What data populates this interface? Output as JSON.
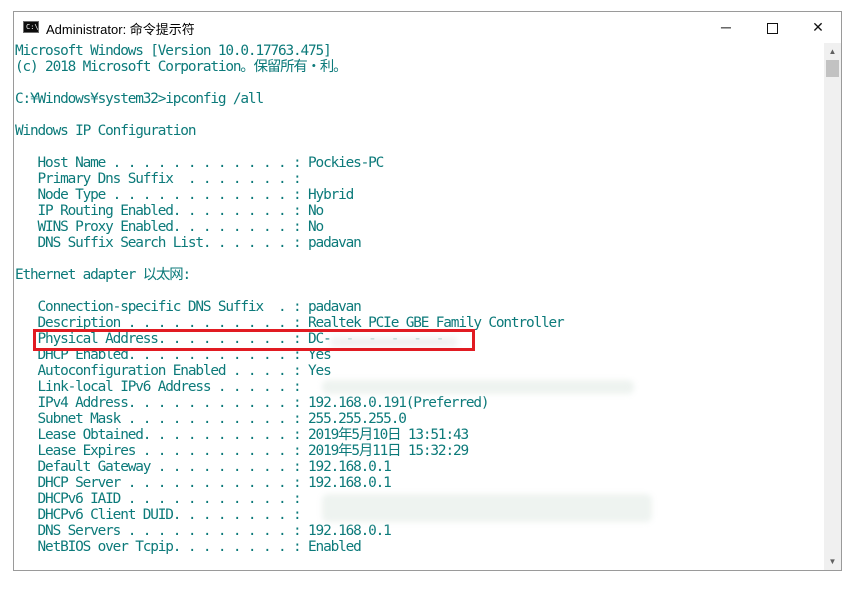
{
  "window": {
    "title": "Administrator: 命令提示符",
    "icon_label": "C:\\",
    "controls": {
      "minimize": "─",
      "close": "✕"
    }
  },
  "console": {
    "lines": [
      "Microsoft Windows [Version 10.0.17763.475]",
      "(c) 2018 Microsoft Corporation。保留所有・利。",
      "",
      "C:¥Windows¥system32>ipconfig /all",
      "",
      "Windows IP Configuration",
      "",
      "   Host Name . . . . . . . . . . . . : Pockies-PC",
      "   Primary Dns Suffix  . . . . . . . :",
      "   Node Type . . . . . . . . . . . . : Hybrid",
      "   IP Routing Enabled. . . . . . . . : No",
      "   WINS Proxy Enabled. . . . . . . . : No",
      "   DNS Suffix Search List. . . . . . : padavan",
      "",
      "Ethernet adapter 以太网:",
      "",
      "   Connection-specific DNS Suffix  . : padavan",
      "   Description . . . . . . . . . . . : Realtek PCIe GBE Family Controller",
      "   Physical Address. . . . . . . . . : DC-  -  -  -  -  -",
      "   DHCP Enabled. . . . . . . . . . . : Yes",
      "   Autoconfiguration Enabled . . . . : Yes",
      "   Link-local IPv6 Address . . . . . :",
      "   IPv4 Address. . . . . . . . . . . : 192.168.0.191(Preferred)",
      "   Subnet Mask . . . . . . . . . . . : 255.255.255.0",
      "   Lease Obtained. . . . . . . . . . : 2019年5月10日 13:51:43",
      "   Lease Expires . . . . . . . . . . : 2019年5月11日 15:32:29",
      "   Default Gateway . . . . . . . . . : 192.168.0.1",
      "   DHCP Server . . . . . . . . . . . : 192.168.0.1",
      "   DHCPv6 IAID . . . . . . . . . . . :",
      "   DHCPv6 Client DUID. . . . . . . . :",
      "   DNS Servers . . . . . . . . . . . : 192.168.0.1",
      "   NetBIOS over Tcpip. . . . . . . . : Enabled"
    ]
  },
  "colors": {
    "console_text": "#0c7a7a",
    "console_bg": "#ffffff",
    "highlight_box": "#e11b22"
  },
  "icons": {
    "app": "console-app-icon",
    "minimize": "minimize-icon",
    "maximize": "maximize-icon",
    "close": "close-icon",
    "scroll_up": "chevron-up-icon",
    "scroll_down": "chevron-down-icon"
  }
}
